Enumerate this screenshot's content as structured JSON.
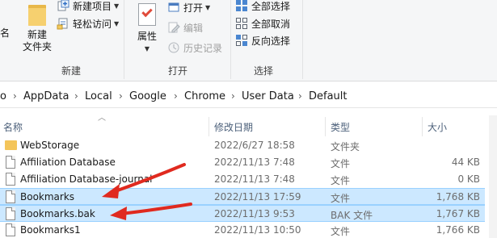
{
  "ribbon": {
    "new_group": {
      "partial_label": "名",
      "new_folder": "新建\n文件夹",
      "new_item": "新建项目",
      "easy_access": "轻松访问",
      "group_label": "新建"
    },
    "open_group": {
      "properties": "属性",
      "open": "打开",
      "edit": "编辑",
      "history": "历史记录",
      "group_label": "打开"
    },
    "select_group": {
      "select_all": "全部选择",
      "select_none": "全部取消",
      "invert": "反向选择",
      "group_label": "选择"
    }
  },
  "address": {
    "crumbs": [
      "o",
      "AppData",
      "Local",
      "Google",
      "Chrome",
      "User Data",
      "Default"
    ],
    "separator": "›"
  },
  "columns": {
    "name": "名称",
    "date": "修改日期",
    "type": "类型",
    "size": "大小"
  },
  "files": [
    {
      "name": "WebStorage",
      "date": "2022/6/27 18:58",
      "type": "文件夹",
      "size": "",
      "kind": "folder",
      "selected": false
    },
    {
      "name": "Affiliation Database",
      "date": "2022/11/13 7:48",
      "type": "文件",
      "size": "44 KB",
      "kind": "file",
      "selected": false
    },
    {
      "name": "Affiliation Database-journal",
      "date": "2022/11/13 7:48",
      "type": "文件",
      "size": "0 KB",
      "kind": "file",
      "selected": false
    },
    {
      "name": "Bookmarks",
      "date": "2022/11/13 17:59",
      "type": "文件",
      "size": "1,768 KB",
      "kind": "file",
      "selected": true
    },
    {
      "name": "Bookmarks.bak",
      "date": "2022/11/13 9:53",
      "type": "BAK 文件",
      "size": "1,767 KB",
      "kind": "file",
      "selected": true
    },
    {
      "name": "Bookmarks1",
      "date": "2022/11/13 10:50",
      "type": "文件",
      "size": "1,766 KB",
      "kind": "file",
      "selected": false
    }
  ],
  "colors": {
    "selection": "#cce8ff",
    "selection_border": "#99d1ff",
    "annotation_arrow": "#e02a1f",
    "ribbon_bg": "#f5f6f7"
  }
}
